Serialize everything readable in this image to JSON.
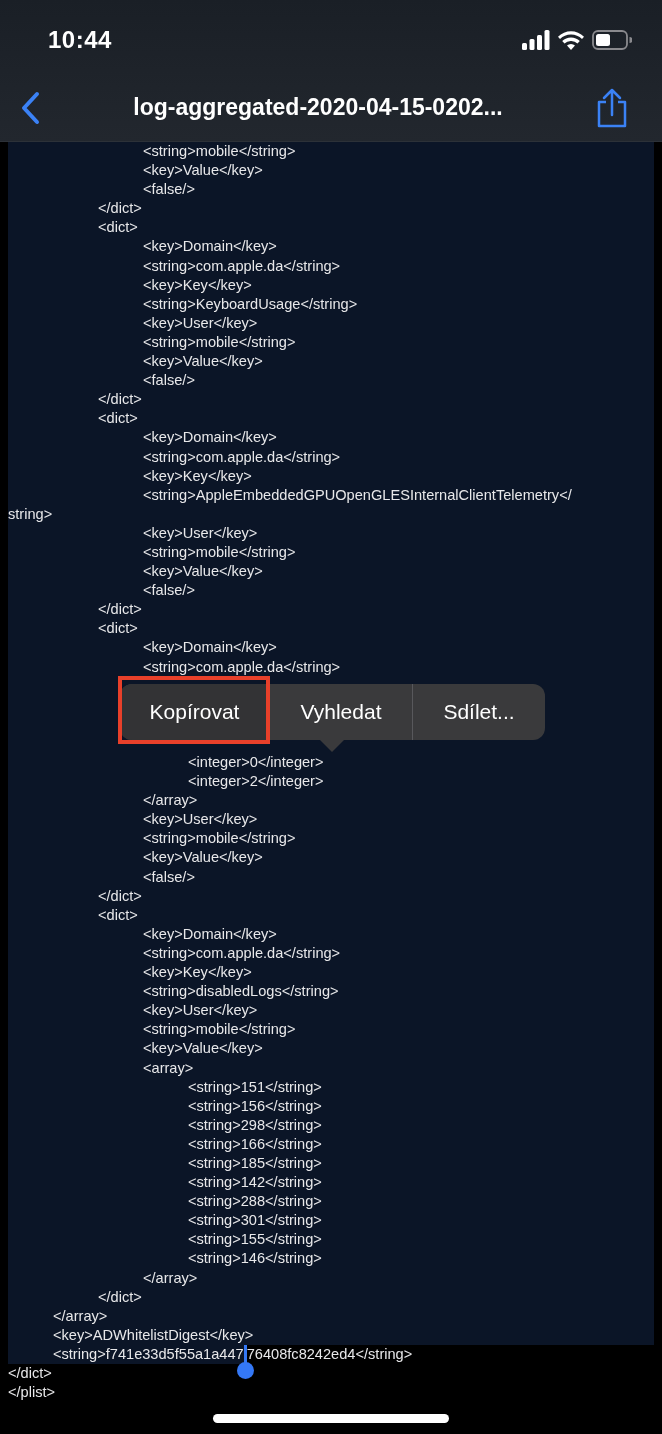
{
  "status_bar": {
    "time": "10:44"
  },
  "nav": {
    "title": "log-aggregated-2020-04-15-0202..."
  },
  "lines_above": [
    {
      "text": "\t\t\t<string>mobile</string>",
      "selected": true
    },
    {
      "text": "\t\t\t<key>Value</key>",
      "selected": true
    },
    {
      "text": "\t\t\t<false/>",
      "selected": true
    },
    {
      "text": "\t\t</dict>",
      "selected": true
    },
    {
      "text": "\t\t<dict>",
      "selected": true
    },
    {
      "text": "\t\t\t<key>Domain</key>",
      "selected": true
    },
    {
      "text": "\t\t\t<string>com.apple.da</string>",
      "selected": true
    },
    {
      "text": "\t\t\t<key>Key</key>",
      "selected": true
    },
    {
      "text": "\t\t\t<string>KeyboardUsage</string>",
      "selected": true
    },
    {
      "text": "\t\t\t<key>User</key>",
      "selected": true
    },
    {
      "text": "\t\t\t<string>mobile</string>",
      "selected": true
    },
    {
      "text": "\t\t\t<key>Value</key>",
      "selected": true
    },
    {
      "text": "\t\t\t<false/>",
      "selected": true
    },
    {
      "text": "\t\t</dict>",
      "selected": true
    },
    {
      "text": "\t\t<dict>",
      "selected": true
    },
    {
      "text": "\t\t\t<key>Domain</key>",
      "selected": true
    },
    {
      "text": "\t\t\t<string>com.apple.da</string>",
      "selected": true
    },
    {
      "text": "\t\t\t<key>Key</key>",
      "selected": true
    },
    {
      "text": "\t\t\t<string>AppleEmbeddedGPUOpenGLESInternalClientTelemetry</",
      "selected": true
    },
    {
      "text": "string>",
      "selected": true
    },
    {
      "text": "\t\t\t<key>User</key>",
      "selected": true
    },
    {
      "text": "\t\t\t<string>mobile</string>",
      "selected": true
    },
    {
      "text": "\t\t\t<key>Value</key>",
      "selected": true
    },
    {
      "text": "\t\t\t<false/>",
      "selected": true
    },
    {
      "text": "\t\t</dict>",
      "selected": true
    },
    {
      "text": "\t\t<dict>",
      "selected": true
    },
    {
      "text": "\t\t\t<key>Domain</key>",
      "selected": true
    },
    {
      "text": "\t\t\t<string>com.apple.da</string>",
      "selected": true
    }
  ],
  "context_menu": {
    "items": [
      {
        "label": "Kopírovat",
        "highlighted": true
      },
      {
        "label": "Vyhledat",
        "highlighted": false
      },
      {
        "label": "Sdílet...",
        "highlighted": false
      }
    ]
  },
  "lines_below": [
    {
      "text": "\t\t\t\t<integer>0</integer>",
      "selected": true
    },
    {
      "text": "\t\t\t\t<integer>2</integer>",
      "selected": true
    },
    {
      "text": "\t\t\t</array>",
      "selected": true
    },
    {
      "text": "\t\t\t<key>User</key>",
      "selected": true
    },
    {
      "text": "\t\t\t<string>mobile</string>",
      "selected": true
    },
    {
      "text": "\t\t\t<key>Value</key>",
      "selected": true
    },
    {
      "text": "\t\t\t<false/>",
      "selected": true
    },
    {
      "text": "\t\t</dict>",
      "selected": true
    },
    {
      "text": "\t\t<dict>",
      "selected": true
    },
    {
      "text": "\t\t\t<key>Domain</key>",
      "selected": true
    },
    {
      "text": "\t\t\t<string>com.apple.da</string>",
      "selected": true
    },
    {
      "text": "\t\t\t<key>Key</key>",
      "selected": true
    },
    {
      "text": "\t\t\t<string>disabledLogs</string>",
      "selected": true
    },
    {
      "text": "\t\t\t<key>User</key>",
      "selected": true
    },
    {
      "text": "\t\t\t<string>mobile</string>",
      "selected": true
    },
    {
      "text": "\t\t\t<key>Value</key>",
      "selected": true
    },
    {
      "text": "\t\t\t<array>",
      "selected": true
    },
    {
      "text": "\t\t\t\t<string>151</string>",
      "selected": true
    },
    {
      "text": "\t\t\t\t<string>156</string>",
      "selected": true
    },
    {
      "text": "\t\t\t\t<string>298</string>",
      "selected": true
    },
    {
      "text": "\t\t\t\t<string>166</string>",
      "selected": true
    },
    {
      "text": "\t\t\t\t<string>185</string>",
      "selected": true
    },
    {
      "text": "\t\t\t\t<string>142</string>",
      "selected": true
    },
    {
      "text": "\t\t\t\t<string>288</string>",
      "selected": true
    },
    {
      "text": "\t\t\t\t<string>301</string>",
      "selected": true
    },
    {
      "text": "\t\t\t\t<string>155</string>",
      "selected": true
    },
    {
      "text": "\t\t\t\t<string>146</string>",
      "selected": true
    },
    {
      "text": "\t\t\t</array>",
      "selected": true
    },
    {
      "text": "\t\t</dict>",
      "selected": true
    },
    {
      "text": "\t</array>",
      "selected": true
    },
    {
      "text": "\t<key>ADWhitelistDigest</key>",
      "selected": true
    },
    {
      "text_selected": "\t<string>f741e33d5f55a1a447",
      "text_unselected": "76408fc8242ed4</string>"
    },
    {
      "text": "</dict>",
      "selected": false
    },
    {
      "text": "</plist>",
      "selected": false
    }
  ]
}
